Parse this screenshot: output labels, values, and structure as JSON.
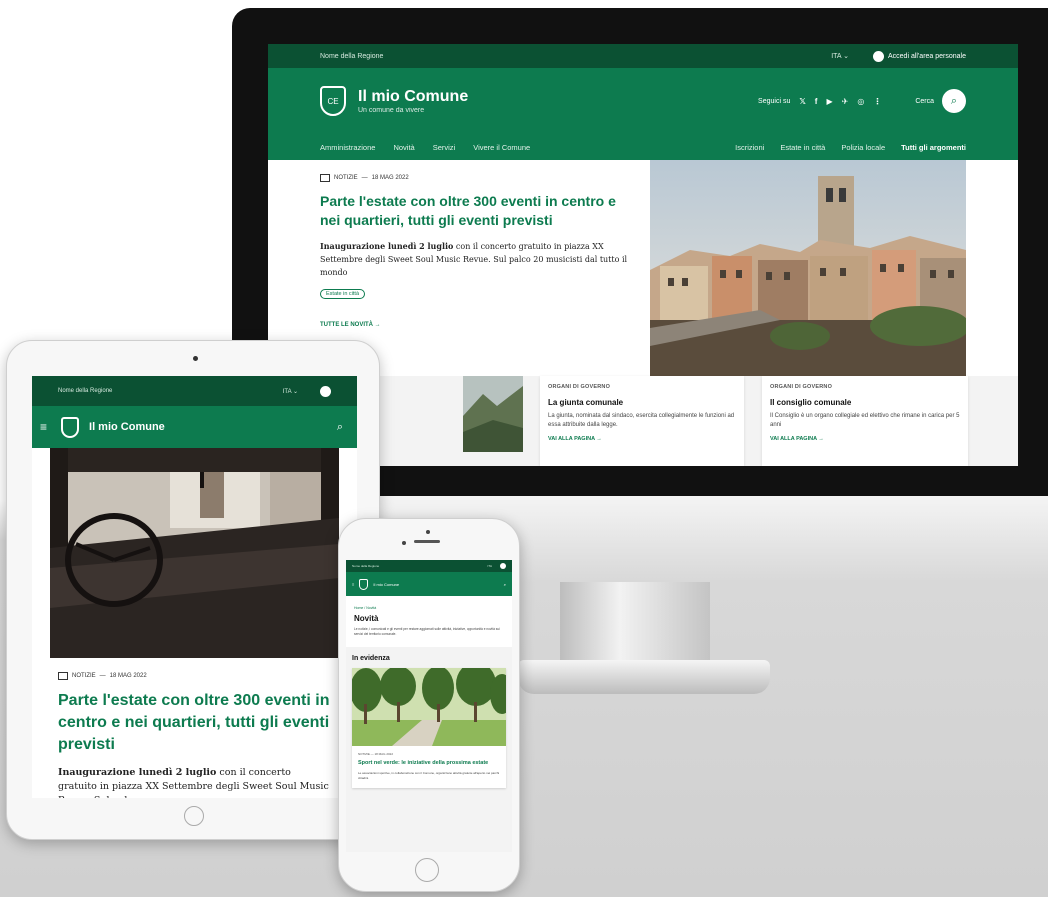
{
  "desktop": {
    "topbar": {
      "region": "Nome della Regione",
      "lang": "ITA",
      "login": "Accedi all'area personale"
    },
    "header": {
      "crest_text": "CE",
      "title": "Il mio Comune",
      "subtitle": "Un comune da vivere",
      "follow_label": "Seguici su",
      "social_icons": [
        "twitter-icon",
        "facebook-icon",
        "youtube-icon",
        "telegram-icon",
        "whatsapp-icon",
        "rss-icon"
      ],
      "social_glyphs": [
        "𝕏",
        "f",
        "▶",
        "✈",
        "◎",
        "⋮"
      ],
      "search_label": "Cerca",
      "search_glyph": "⌕"
    },
    "nav": {
      "main": [
        "Amministrazione",
        "Novità",
        "Servizi",
        "Vivere il Comune"
      ],
      "secondary": [
        "Iscrizioni",
        "Estate in città",
        "Polizia locale"
      ],
      "all_topics": "Tutti gli argomenti"
    },
    "hero": {
      "meta_category": "NOTIZIE",
      "meta_date": "18 MAG 2022",
      "title": "Parte l'estate con oltre 300 eventi in centro e nei quartieri, tutti gli eventi previsti",
      "body_bold": "Inaugurazione lunedì 2 luglio",
      "body_rest": " con il concerto gratuito in piazza XX Settembre degli Sweet Soul Music Revue. Sul palco 20 musicisti dal tutto il mondo",
      "chip": "Estate in città",
      "all_link": "TUTTE LE NOVITÀ →"
    },
    "cards": [
      {
        "kicker": "ORGANI DI GOVERNO",
        "title": "La giunta comunale",
        "desc": "La giunta, nominata dal sindaco, esercita collegialmente le funzioni ad essa attribuite dalla legge.",
        "link": "VAI ALLA PAGINA →"
      },
      {
        "kicker": "ORGANI DI GOVERNO",
        "title": "Il consiglio comunale",
        "desc": "Il Consiglio è un organo collegiale ed elettivo che rimane in carica per 5 anni",
        "link": "VAI ALLA PAGINA →"
      }
    ]
  },
  "tablet": {
    "topbar": {
      "region": "Nome della Regione",
      "lang": "ITA"
    },
    "header": {
      "menu_glyph": "≡",
      "title": "Il mio Comune",
      "search_glyph": "⌕"
    },
    "meta_category": "NOTIZIE",
    "meta_date": "18 MAG 2022",
    "title": "Parte l'estate con oltre 300 eventi in centro e nei quartieri, tutti gli eventi previsti",
    "body_bold": "Inaugurazione lunedì 2 luglio",
    "body_rest": " con il concerto gratuito in piazza XX Settembre degli Sweet Soul Music Revue. Sul palco"
  },
  "phone": {
    "topbar": {
      "region": "Nome della Regione",
      "lang": "ITA"
    },
    "header": {
      "menu_glyph": "≡",
      "title": "Il mio Comune",
      "search_glyph": "⌕"
    },
    "breadcrumb": "Home / Novità",
    "page_title": "Novità",
    "intro": "Le notizie, i comunicati e gli eventi per restare aggiornati sulle attività, iniziative, opportunità e novità sui servizi del territorio comunale.",
    "section_title": "In evidenza",
    "card": {
      "meta": "NOTIZIE — 18 MAG 2022",
      "title": "Sport nel verde: le iniziative della prossima estate",
      "text": "Le associazioni sportive, in collaborazione con il Comune, organizzano attività gratuite all'aperto nei parchi cittadini."
    }
  },
  "colors": {
    "primary": "#0d7b4f",
    "primary_dark": "#0b5133"
  }
}
